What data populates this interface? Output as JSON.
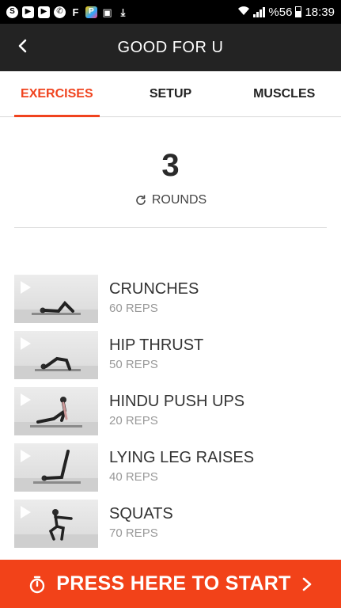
{
  "status_bar": {
    "battery_text": "%56",
    "time": "18:39",
    "left_icons": [
      "skype-icon",
      "youtube-icon",
      "youtube-icon",
      "whatsapp-icon",
      "flipboard-icon",
      "app-icon",
      "image-icon",
      "download-icon"
    ]
  },
  "app_bar": {
    "title": "GOOD FOR U"
  },
  "tabs": [
    {
      "label": "EXERCISES",
      "active": true
    },
    {
      "label": "SETUP",
      "active": false
    },
    {
      "label": "MUSCLES",
      "active": false
    }
  ],
  "rounds": {
    "count": "3",
    "label": "ROUNDS"
  },
  "exercises": [
    {
      "name": "CRUNCHES",
      "reps": "60 REPS"
    },
    {
      "name": "HIP THRUST",
      "reps": "50 REPS"
    },
    {
      "name": "HINDU PUSH UPS",
      "reps": "20 REPS"
    },
    {
      "name": "LYING LEG RAISES",
      "reps": "40 REPS"
    },
    {
      "name": "SQUATS",
      "reps": "70 REPS"
    }
  ],
  "start_button": {
    "label": "PRESS HERE TO START"
  },
  "colors": {
    "accent": "#f0431e",
    "app_bar": "#232323",
    "start_bar": "#f24219"
  }
}
